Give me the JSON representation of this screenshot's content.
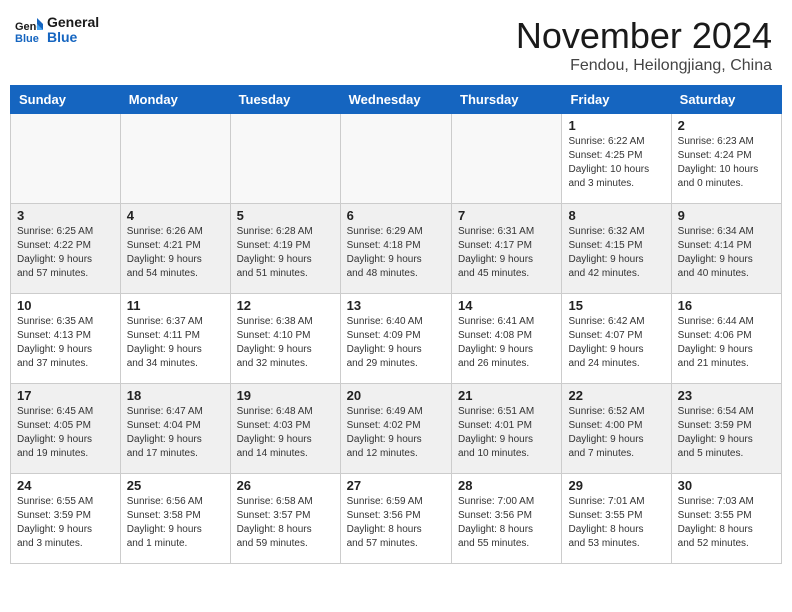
{
  "header": {
    "logo_text_general": "General",
    "logo_text_blue": "Blue",
    "month_title": "November 2024",
    "location": "Fendou, Heilongjiang, China"
  },
  "calendar": {
    "headers": [
      "Sunday",
      "Monday",
      "Tuesday",
      "Wednesday",
      "Thursday",
      "Friday",
      "Saturday"
    ],
    "weeks": [
      [
        {
          "day": "",
          "info": ""
        },
        {
          "day": "",
          "info": ""
        },
        {
          "day": "",
          "info": ""
        },
        {
          "day": "",
          "info": ""
        },
        {
          "day": "",
          "info": ""
        },
        {
          "day": "1",
          "info": "Sunrise: 6:22 AM\nSunset: 4:25 PM\nDaylight: 10 hours\nand 3 minutes."
        },
        {
          "day": "2",
          "info": "Sunrise: 6:23 AM\nSunset: 4:24 PM\nDaylight: 10 hours\nand 0 minutes."
        }
      ],
      [
        {
          "day": "3",
          "info": "Sunrise: 6:25 AM\nSunset: 4:22 PM\nDaylight: 9 hours\nand 57 minutes."
        },
        {
          "day": "4",
          "info": "Sunrise: 6:26 AM\nSunset: 4:21 PM\nDaylight: 9 hours\nand 54 minutes."
        },
        {
          "day": "5",
          "info": "Sunrise: 6:28 AM\nSunset: 4:19 PM\nDaylight: 9 hours\nand 51 minutes."
        },
        {
          "day": "6",
          "info": "Sunrise: 6:29 AM\nSunset: 4:18 PM\nDaylight: 9 hours\nand 48 minutes."
        },
        {
          "day": "7",
          "info": "Sunrise: 6:31 AM\nSunset: 4:17 PM\nDaylight: 9 hours\nand 45 minutes."
        },
        {
          "day": "8",
          "info": "Sunrise: 6:32 AM\nSunset: 4:15 PM\nDaylight: 9 hours\nand 42 minutes."
        },
        {
          "day": "9",
          "info": "Sunrise: 6:34 AM\nSunset: 4:14 PM\nDaylight: 9 hours\nand 40 minutes."
        }
      ],
      [
        {
          "day": "10",
          "info": "Sunrise: 6:35 AM\nSunset: 4:13 PM\nDaylight: 9 hours\nand 37 minutes."
        },
        {
          "day": "11",
          "info": "Sunrise: 6:37 AM\nSunset: 4:11 PM\nDaylight: 9 hours\nand 34 minutes."
        },
        {
          "day": "12",
          "info": "Sunrise: 6:38 AM\nSunset: 4:10 PM\nDaylight: 9 hours\nand 32 minutes."
        },
        {
          "day": "13",
          "info": "Sunrise: 6:40 AM\nSunset: 4:09 PM\nDaylight: 9 hours\nand 29 minutes."
        },
        {
          "day": "14",
          "info": "Sunrise: 6:41 AM\nSunset: 4:08 PM\nDaylight: 9 hours\nand 26 minutes."
        },
        {
          "day": "15",
          "info": "Sunrise: 6:42 AM\nSunset: 4:07 PM\nDaylight: 9 hours\nand 24 minutes."
        },
        {
          "day": "16",
          "info": "Sunrise: 6:44 AM\nSunset: 4:06 PM\nDaylight: 9 hours\nand 21 minutes."
        }
      ],
      [
        {
          "day": "17",
          "info": "Sunrise: 6:45 AM\nSunset: 4:05 PM\nDaylight: 9 hours\nand 19 minutes."
        },
        {
          "day": "18",
          "info": "Sunrise: 6:47 AM\nSunset: 4:04 PM\nDaylight: 9 hours\nand 17 minutes."
        },
        {
          "day": "19",
          "info": "Sunrise: 6:48 AM\nSunset: 4:03 PM\nDaylight: 9 hours\nand 14 minutes."
        },
        {
          "day": "20",
          "info": "Sunrise: 6:49 AM\nSunset: 4:02 PM\nDaylight: 9 hours\nand 12 minutes."
        },
        {
          "day": "21",
          "info": "Sunrise: 6:51 AM\nSunset: 4:01 PM\nDaylight: 9 hours\nand 10 minutes."
        },
        {
          "day": "22",
          "info": "Sunrise: 6:52 AM\nSunset: 4:00 PM\nDaylight: 9 hours\nand 7 minutes."
        },
        {
          "day": "23",
          "info": "Sunrise: 6:54 AM\nSunset: 3:59 PM\nDaylight: 9 hours\nand 5 minutes."
        }
      ],
      [
        {
          "day": "24",
          "info": "Sunrise: 6:55 AM\nSunset: 3:59 PM\nDaylight: 9 hours\nand 3 minutes."
        },
        {
          "day": "25",
          "info": "Sunrise: 6:56 AM\nSunset: 3:58 PM\nDaylight: 9 hours\nand 1 minute."
        },
        {
          "day": "26",
          "info": "Sunrise: 6:58 AM\nSunset: 3:57 PM\nDaylight: 8 hours\nand 59 minutes."
        },
        {
          "day": "27",
          "info": "Sunrise: 6:59 AM\nSunset: 3:56 PM\nDaylight: 8 hours\nand 57 minutes."
        },
        {
          "day": "28",
          "info": "Sunrise: 7:00 AM\nSunset: 3:56 PM\nDaylight: 8 hours\nand 55 minutes."
        },
        {
          "day": "29",
          "info": "Sunrise: 7:01 AM\nSunset: 3:55 PM\nDaylight: 8 hours\nand 53 minutes."
        },
        {
          "day": "30",
          "info": "Sunrise: 7:03 AM\nSunset: 3:55 PM\nDaylight: 8 hours\nand 52 minutes."
        }
      ]
    ]
  }
}
